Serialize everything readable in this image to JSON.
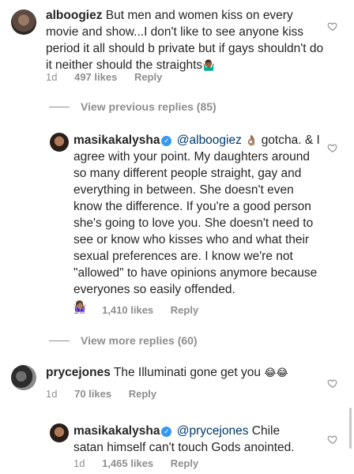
{
  "comments": [
    {
      "username": "alboogiez",
      "text": "But men and women kiss on every movie and show...I don't like to see anyone kiss period it all should b private but if gays shouldn't do it neither should the straights",
      "emoji": "🤷🏾‍♂️",
      "time": "1d",
      "likes": "497 likes",
      "reply": "Reply"
    },
    {
      "toggle": "View previous replies (85)"
    },
    {
      "username": "masikakalysha",
      "mention": "@alboogiez",
      "mention_emoji": "👌🏽",
      "text": "gotcha. & I agree with your point. My daughters around so many different people straight, gay and everything in between. She doesn't even know the difference. If you're a good person she's going to love you. She doesn't need to see or know who kisses who and what their sexual preferences are. I know we're not \"allowed\" to have opinions anymore because everyones so easily offended.",
      "emoji": "🤷🏽‍♀️",
      "time": "1d",
      "likes": "1,410 likes",
      "reply": "Reply"
    },
    {
      "toggle": "View more replies (60)"
    },
    {
      "username": "prycejones",
      "text": "The Illuminati gone get you",
      "emoji": "😂😂",
      "time": "1d",
      "likes": "70 likes",
      "reply": "Reply"
    },
    {
      "username": "masikakalysha",
      "mention": "@prycejones",
      "text": "Chile satan himself can't touch Gods anointed.",
      "time": "1d",
      "likes": "1,465 likes",
      "reply": "Reply"
    }
  ],
  "colors": {
    "text": "#262626",
    "secondary": "#8e8e8e",
    "mention": "#00376b",
    "verified": "#3897f0"
  },
  "icons": {
    "like": "heart-outline-icon",
    "verified": "verified-badge-icon"
  }
}
